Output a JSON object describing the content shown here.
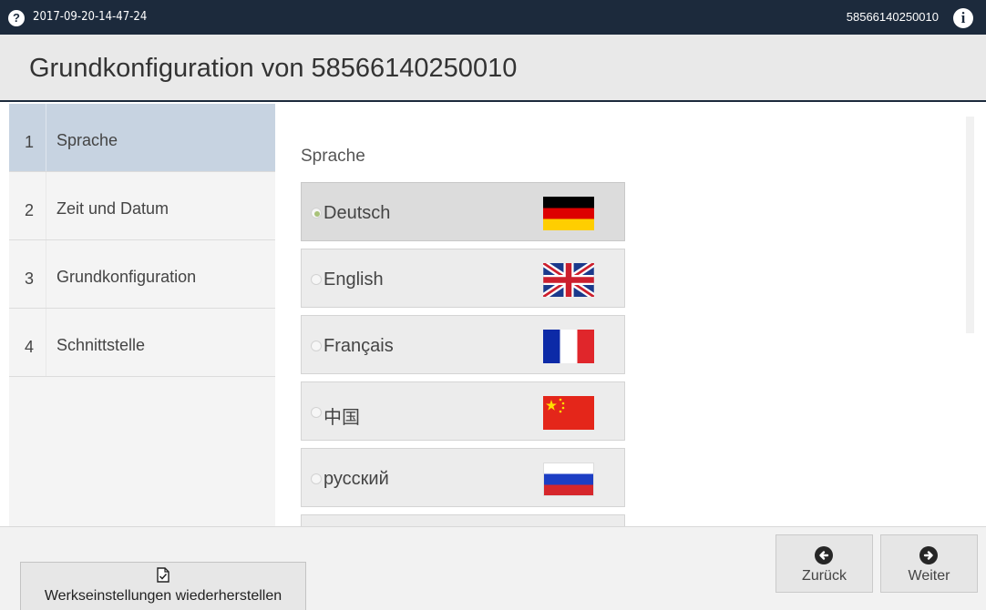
{
  "topbar": {
    "help_icon": "?",
    "timestamp": "2017-09-20-14-47-24",
    "serial": "58566140250010",
    "info_icon": "i"
  },
  "title": "Grundkonfiguration von 58566140250010",
  "sidebar": {
    "items": [
      {
        "num": "1",
        "label": "Sprache",
        "active": true
      },
      {
        "num": "2",
        "label": "Zeit und Datum",
        "active": false
      },
      {
        "num": "3",
        "label": "Grundkonfiguration",
        "active": false
      },
      {
        "num": "4",
        "label": "Schnittstelle",
        "active": false
      }
    ]
  },
  "content": {
    "heading": "Sprache",
    "languages": [
      {
        "label": "Deutsch",
        "flag": "de",
        "selected": true
      },
      {
        "label": "English",
        "flag": "uk",
        "selected": false
      },
      {
        "label": "Français",
        "flag": "fr",
        "selected": false
      },
      {
        "label": "中国",
        "flag": "cn",
        "selected": false
      },
      {
        "label": "русский",
        "flag": "ru",
        "selected": false
      }
    ]
  },
  "footer": {
    "reset_label": "Werkseinstellungen wiederherstellen",
    "back_label": "Zurück",
    "next_label": "Weiter"
  },
  "colors": {
    "topbar": "#1c2a3c",
    "active_nav": "#c7d3e1",
    "radio_on": "#a9c27a"
  }
}
